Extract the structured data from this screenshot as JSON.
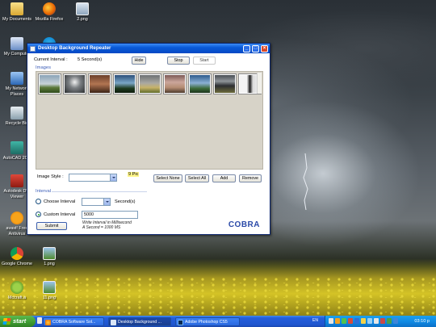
{
  "desktop": {
    "icons": [
      {
        "label": "My Documents"
      },
      {
        "label": "Mozilla Firefox"
      },
      {
        "label": "2.png"
      },
      {
        "label": "My Computer"
      },
      {
        "label": ""
      },
      {
        "label": "My Network Places"
      },
      {
        "label": "Recycle Bin"
      },
      {
        "label": "AutoCAD 20..."
      },
      {
        "label": "Autodesk DW Viewer"
      },
      {
        "label": "avast! Free Antivirus"
      },
      {
        "label": "Google Chrome"
      },
      {
        "label": "1.png"
      },
      {
        "label": "Mccraft.a"
      },
      {
        "label": "11.png"
      }
    ]
  },
  "window": {
    "title": "Desktop Background Repeater",
    "current_interval_label": "Current Interval :",
    "current_interval_value": "5 Second(s)",
    "hide_label": "Hide",
    "stop_label": "Stop",
    "start_label": "Start",
    "images_group_title": "Images",
    "thumbnail_count": 9,
    "image_style_label": "Image Style :",
    "image_style_value": "",
    "pic_count_label": "9 Pic",
    "select_none_label": "Select None",
    "select_all_label": "Select All",
    "add_label": "Add",
    "remove_label": "Remove",
    "interval_group_title": "Interval",
    "choose_interval_label": "Choose Interval",
    "choose_interval_value": "",
    "seconds_label": "Second(s)",
    "custom_interval_label": "Custom Interval",
    "custom_interval_value": "5000",
    "hint_line1": "Write Interval in Millisecond",
    "hint_line2": "A Second = 1000 MS",
    "submit_label": "Submit",
    "logo_text": "COBRA",
    "logo_subtext": ""
  },
  "taskbar": {
    "start_label": "start",
    "tasks": [
      {
        "label": "COBRA Software Sol..."
      },
      {
        "label": "Desktop Background ..."
      },
      {
        "label": "Adobe Photoshop CS5"
      }
    ],
    "language": "EN",
    "clock": "03:10 p"
  },
  "colors": {
    "taskbar_blue": "#245edb",
    "titlebar_blue": "#0a5ad8",
    "start_green": "#3c9a30",
    "group_title_blue": "#3d5eb8"
  }
}
